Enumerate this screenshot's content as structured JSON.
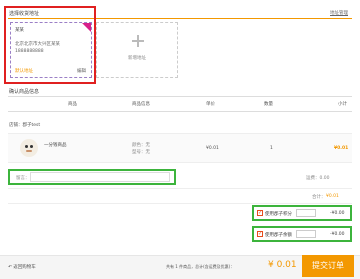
{
  "address_section": {
    "title": "选择收货地址",
    "manage_link": "地址管理",
    "card": {
      "name": "某某",
      "address": "北京北京市大兴区某某",
      "phone": "1888888888",
      "default_tag": "默认地址",
      "edit_link": "编辑"
    },
    "add_new_label": "新增地址"
  },
  "goods_section": {
    "title": "确认商品信息",
    "columns": [
      "商品",
      "商品信息",
      "单价",
      "数量",
      "小计"
    ],
    "shop_label": "店铺：郡子test",
    "item": {
      "name": "一分钱商品",
      "spec1": "颜色：无",
      "spec2": "型号：无",
      "unit_price": "¥0.01",
      "quantity": "1",
      "subtotal": "¥0.01"
    },
    "remark_label": "留言：",
    "remark_placeholder": "",
    "shipping_label": "运费：0.00",
    "total_label": "合计：",
    "total_value": "¥0.01"
  },
  "discounts": {
    "points_label": "使用郡子积分",
    "points_amount": "-¥0.00",
    "balance_label": "使用郡子余额",
    "balance_amount": "-¥0.00"
  },
  "footer": {
    "back_link": "返回购物车",
    "summary_text": "共有 1 件商品，总计(含运费及优惠)：",
    "total_amount": "¥ 0.01",
    "submit_label": "提交订单"
  },
  "colors": {
    "accent": "#f39800",
    "highlight_red": "#e02020",
    "highlight_green": "#3cb43c",
    "card_border": "#9b7fc6",
    "corner": "#d8208a"
  }
}
